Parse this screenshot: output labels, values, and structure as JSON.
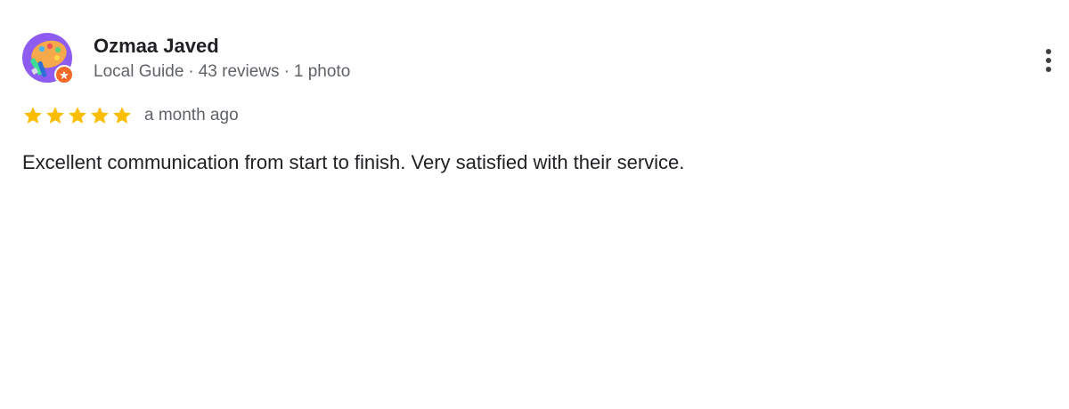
{
  "review": {
    "author": {
      "name": "Ozmaa Javed",
      "guide_label": "Local Guide",
      "reviews": "43 reviews",
      "photos": "1 photo",
      "separator": "·",
      "avatar_icon": "palette-painting-avatar-icon",
      "badge_icon": "local-guide-star-badge-icon"
    },
    "rating": {
      "value": 5,
      "max": 5,
      "star_color": "#fbbc04"
    },
    "timestamp": "a month ago",
    "text": "Excellent communication from start to finish. Very satisfied with their service.",
    "menu_icon": "more-vert-icon"
  },
  "colors": {
    "name": "#202124",
    "secondary": "#5f6368",
    "avatar_bg": "#8e5cf0",
    "badge_bg": "#f26b2b"
  }
}
